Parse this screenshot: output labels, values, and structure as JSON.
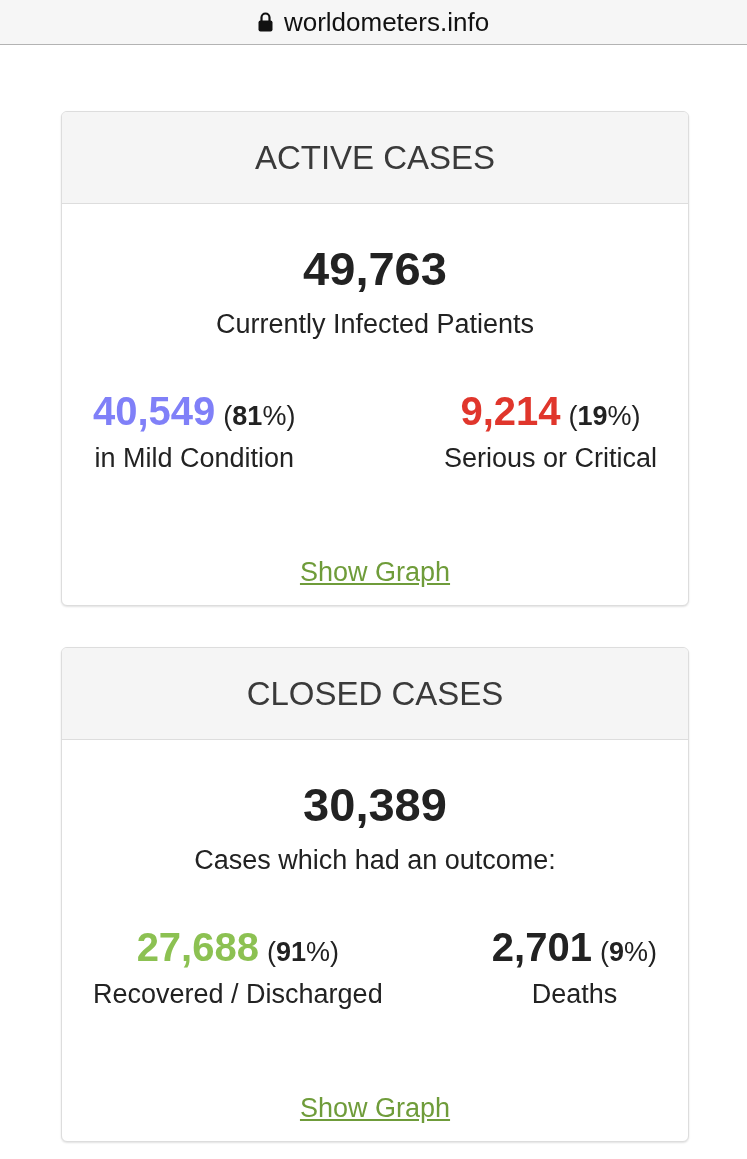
{
  "address_bar": {
    "url": "worldometers.info",
    "secure": true
  },
  "cards": [
    {
      "title": "ACTIVE CASES",
      "total": "49,763",
      "caption": "Currently Infected Patients",
      "stats": [
        {
          "value": "40,549",
          "percent": "(**81**%)",
          "label": "in Mild Condition",
          "color": "#8080f8"
        },
        {
          "value": "9,214",
          "percent": "(**19**%)",
          "label": "Serious or Critical",
          "color": "#e0362c"
        }
      ],
      "link": "Show Graph"
    },
    {
      "title": "CLOSED CASES",
      "total": "30,389",
      "caption": "Cases which had an outcome:",
      "stats": [
        {
          "value": "27,688",
          "percent": "(**91**%)",
          "label": "Recovered / Discharged",
          "color": "#8cc152"
        },
        {
          "value": "2,701",
          "percent": "(**9**%)",
          "label": "Deaths",
          "color": "#222222"
        }
      ],
      "link": "Show Graph"
    }
  ]
}
